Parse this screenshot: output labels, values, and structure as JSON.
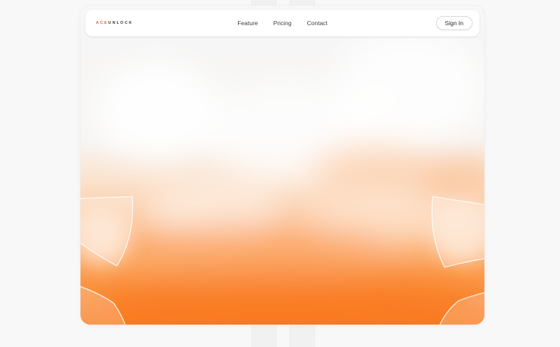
{
  "brand": {
    "logo_accent": "ACE",
    "logo_rest": "UNLOCK",
    "accent_color": "#e05a3a"
  },
  "nav": {
    "links": [
      {
        "label": "Feature"
      },
      {
        "label": "Pricing"
      },
      {
        "label": "Contact"
      }
    ],
    "signin_label": "Sign In"
  },
  "theme": {
    "hero_gradient_color": "#fb7e22",
    "background": "#f8f8f8"
  }
}
